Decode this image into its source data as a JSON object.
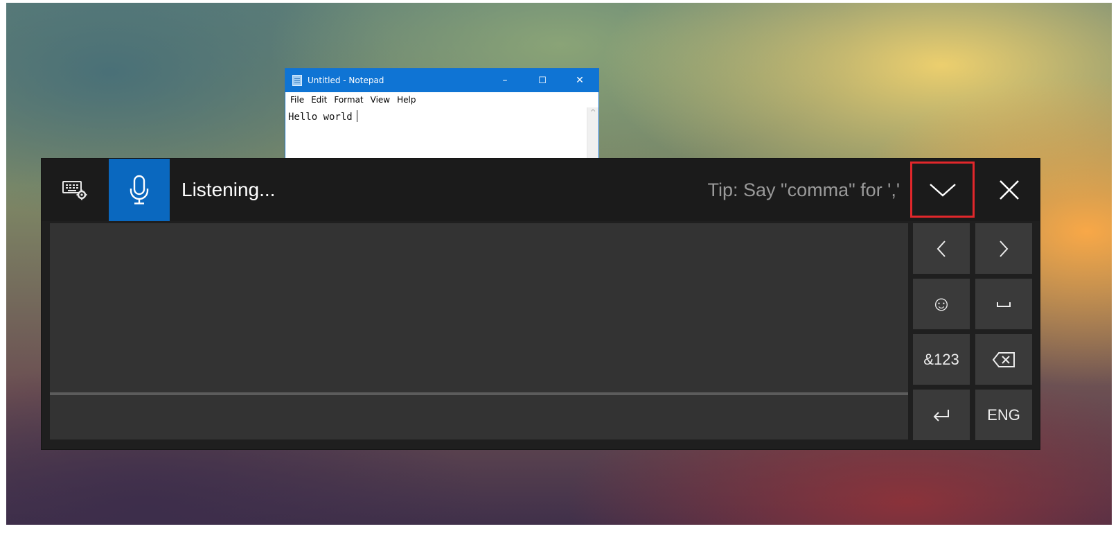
{
  "notepad": {
    "title": "Untitled - Notepad",
    "controls": {
      "minimize": "–",
      "maximize": "☐",
      "close": "✕"
    },
    "menu": [
      "File",
      "Edit",
      "Format",
      "View",
      "Help"
    ],
    "content": "Hello world"
  },
  "dictation": {
    "status": "Listening...",
    "tip": "Tip: Say \"comma\" for ','",
    "mic_color": "#0a68bf",
    "highlight_color": "#e1272b",
    "keys": {
      "left": "<",
      "right": ">",
      "emoji": "☺",
      "space": "⎵",
      "symbols": "&123",
      "backspace": "⌫",
      "enter": "↵",
      "language": "ENG"
    }
  }
}
